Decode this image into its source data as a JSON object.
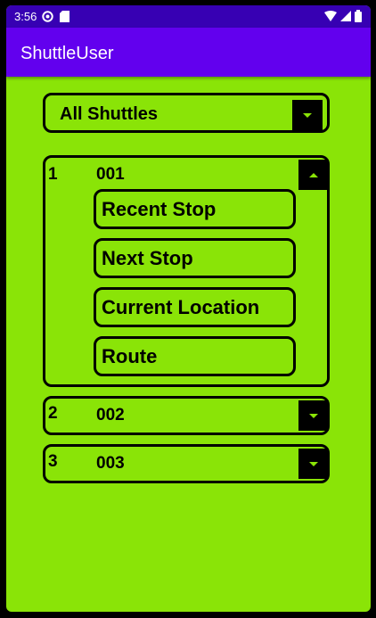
{
  "status_bar": {
    "time": "3:56"
  },
  "app_bar": {
    "title": "ShuttleUser"
  },
  "filter": {
    "selected": "All Shuttles"
  },
  "shuttles": [
    {
      "index": "1",
      "id": "001",
      "expanded": true,
      "actions": [
        "Recent Stop",
        "Next Stop",
        "Current Location",
        "Route"
      ]
    },
    {
      "index": "2",
      "id": "002",
      "expanded": false
    },
    {
      "index": "3",
      "id": "003",
      "expanded": false
    }
  ],
  "colors": {
    "background": "#8ae407",
    "app_bar": "#6200ee",
    "status_bar": "#3700b3",
    "accent": "#8ae407"
  },
  "icons": {
    "expand": "chevron-down-icon",
    "collapse": "chevron-up-icon"
  }
}
